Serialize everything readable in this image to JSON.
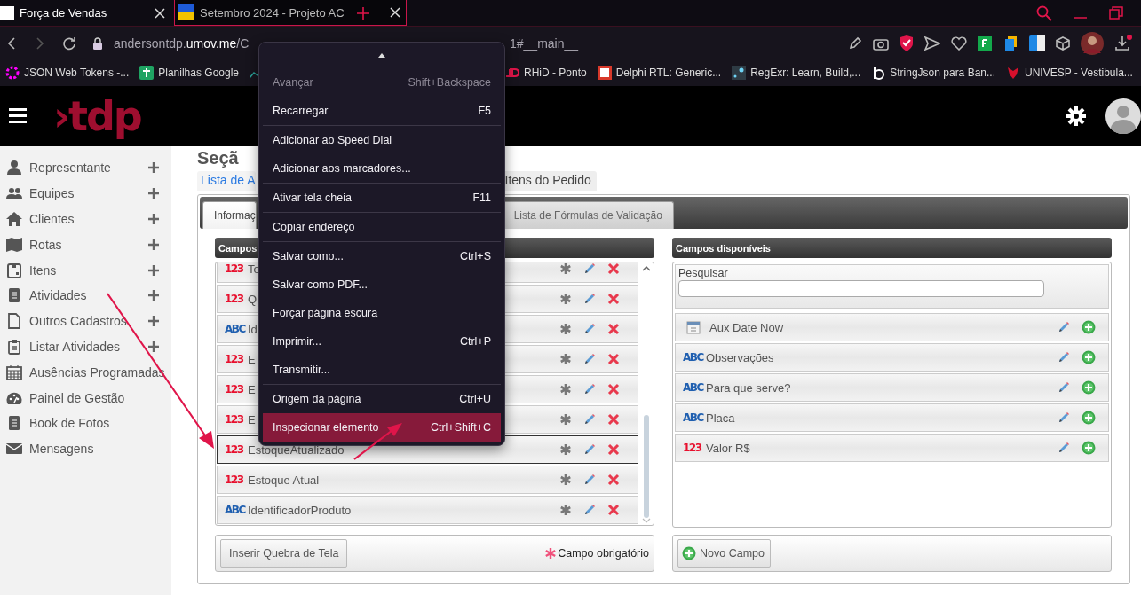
{
  "browser": {
    "tabs": [
      {
        "title": "Força de Vendas",
        "selected": true
      },
      {
        "title": "Setembro 2024 - Projeto AC",
        "selected": false
      }
    ],
    "address": {
      "url_start": "andersontdp.**umov.me**/C",
      "url_end": "1#__main__"
    },
    "bookmarks": [
      {
        "label": "JSON Web Tokens -..."
      },
      {
        "label": "Planilhas Google"
      },
      {
        "label": "RHiD - Ponto"
      },
      {
        "label": "Delphi RTL: Generic..."
      },
      {
        "label": "RegExr: Learn, Build,..."
      },
      {
        "label": "StringJson para Ban..."
      },
      {
        "label": "UNIVESP - Vestibula..."
      }
    ]
  },
  "app": {
    "logo": "›tdp"
  },
  "sidebar": {
    "items": [
      {
        "label": "Representante",
        "addable": true
      },
      {
        "label": "Equipes",
        "addable": true
      },
      {
        "label": "Clientes",
        "addable": true
      },
      {
        "label": "Rotas",
        "addable": true
      },
      {
        "label": "Itens",
        "addable": true
      },
      {
        "label": "Atividades",
        "addable": true
      },
      {
        "label": "Outros Cadastros",
        "addable": true
      },
      {
        "label": "Listar Atividades",
        "addable": true
      },
      {
        "label": "Ausências Programadas",
        "addable": false
      },
      {
        "label": "Painel de Gestão",
        "addable": false
      },
      {
        "label": "Book de Fotos",
        "addable": false
      },
      {
        "label": "Mensagens",
        "addable": false
      }
    ]
  },
  "page": {
    "title": "Seçã",
    "links": [
      {
        "label": "Lista de A",
        "selected": false
      },
      {
        "label": "Itens do Pedido",
        "selected": true
      }
    ],
    "tabs": [
      {
        "label": "Informaç",
        "selected": true
      },
      {
        "label": "Lista de Fórmulas de Validação",
        "selected": false
      }
    ],
    "used_fields": {
      "title": "Campos",
      "rows": [
        {
          "kind": "number",
          "badge": "123",
          "name": "To",
          "selected": false
        },
        {
          "kind": "number",
          "badge": "123",
          "name": "Q",
          "selected": false
        },
        {
          "kind": "text",
          "badge": "ABC",
          "name": "Id",
          "selected": false
        },
        {
          "kind": "number",
          "badge": "123",
          "name": "E",
          "selected": false
        },
        {
          "kind": "number",
          "badge": "123",
          "name": "E",
          "selected": false
        },
        {
          "kind": "number",
          "badge": "123",
          "name": "E",
          "selected": false
        },
        {
          "kind": "number",
          "badge": "123",
          "name": "EstoqueAtualizado",
          "selected": true
        },
        {
          "kind": "number",
          "badge": "123",
          "name": "Estoque Atual",
          "selected": false
        },
        {
          "kind": "text",
          "badge": "ABC",
          "name": "IdentificadorProduto",
          "selected": false
        }
      ],
      "button": "Inserir Quebra de Tela",
      "legend": "Campo obrigatório"
    },
    "available_fields": {
      "title": "Campos disponíveis",
      "search_label": "Pesquisar",
      "rows": [
        {
          "kind": "date",
          "name": "Aux Date Now"
        },
        {
          "kind": "text",
          "badge": "ABC",
          "name": "Observações"
        },
        {
          "kind": "text",
          "badge": "ABC",
          "name": "Para que serve?"
        },
        {
          "kind": "text",
          "badge": "ABC",
          "name": "Placa"
        },
        {
          "kind": "number",
          "badge": "123",
          "name": "Valor R$"
        }
      ],
      "button": "Novo Campo"
    }
  },
  "context_menu": {
    "items": [
      {
        "kind": "item",
        "label": "Avançar",
        "shortcut": "Shift+Backspace",
        "disabled": true,
        "selected": false
      },
      {
        "kind": "item",
        "label": "Recarregar",
        "shortcut": "F5",
        "disabled": false,
        "selected": false
      },
      {
        "kind": "separator"
      },
      {
        "kind": "item",
        "label": "Adicionar ao Speed Dial",
        "disabled": false,
        "selected": false
      },
      {
        "kind": "item",
        "label": "Adicionar aos marcadores...",
        "disabled": false,
        "selected": false
      },
      {
        "kind": "separator"
      },
      {
        "kind": "item",
        "label": "Ativar tela cheia",
        "shortcut": "F11",
        "disabled": false,
        "selected": false
      },
      {
        "kind": "separator"
      },
      {
        "kind": "item",
        "label": "Copiar endereço",
        "disabled": false,
        "selected": false
      },
      {
        "kind": "separator"
      },
      {
        "kind": "item",
        "label": "Salvar como...",
        "shortcut": "Ctrl+S",
        "disabled": false,
        "selected": false
      },
      {
        "kind": "item",
        "label": "Salvar como PDF...",
        "disabled": false,
        "selected": false
      },
      {
        "kind": "item",
        "label": "Forçar página escura",
        "disabled": false,
        "selected": false
      },
      {
        "kind": "item",
        "label": "Imprimir...",
        "shortcut": "Ctrl+P",
        "disabled": false,
        "selected": false
      },
      {
        "kind": "item",
        "label": "Transmitir...",
        "disabled": false,
        "selected": false
      },
      {
        "kind": "separator"
      },
      {
        "kind": "item",
        "label": "Origem da página",
        "shortcut": "Ctrl+U",
        "disabled": false,
        "selected": false
      },
      {
        "kind": "item",
        "label": "Inspecionar elemento",
        "shortcut": "Ctrl+Shift+C",
        "disabled": false,
        "selected": true
      }
    ]
  }
}
